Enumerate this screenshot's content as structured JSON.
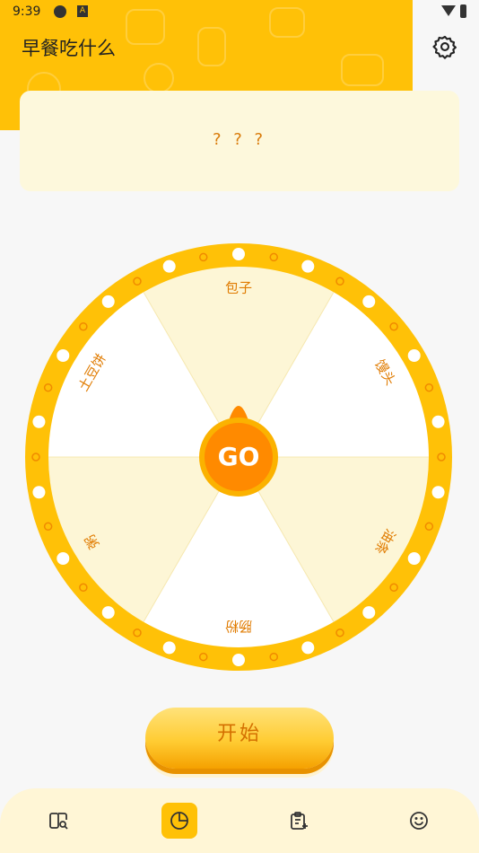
{
  "status_bar": {
    "time": "9:39"
  },
  "header": {
    "title": "早餐吃什么"
  },
  "result": {
    "text": "? ? ?"
  },
  "wheel": {
    "go_label": "GO",
    "segments": [
      "包子",
      "馒头",
      "油条",
      "肠粉",
      "粥",
      "土豆饼"
    ]
  },
  "start_button": {
    "label": "开始"
  },
  "colors": {
    "accent": "#ffc107",
    "accent_dark": "#f5a100",
    "go_orange": "#ff8a00",
    "segment_text": "#e07b00",
    "segment_light": "#ffffff",
    "segment_tint": "#fdf6d6"
  },
  "nav": {
    "items": [
      {
        "icon": "book-search-icon"
      },
      {
        "icon": "pie-chart-icon",
        "active": true
      },
      {
        "icon": "clipboard-add-icon"
      },
      {
        "icon": "smile-icon"
      }
    ]
  }
}
